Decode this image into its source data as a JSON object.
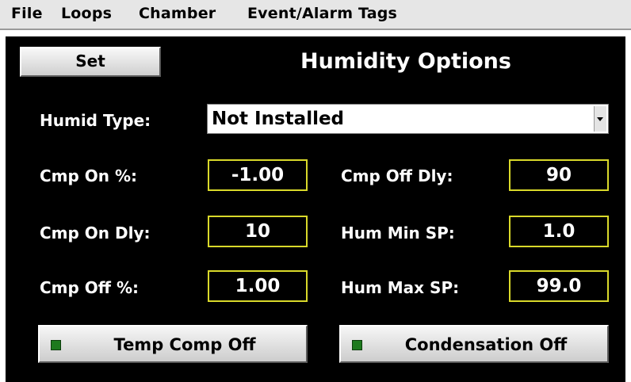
{
  "menu": {
    "file": "File",
    "loops": "Loops",
    "chamber": "Chamber",
    "event_alarm_tags": "Event/Alarm Tags"
  },
  "toolbar": {
    "set_label": "Set"
  },
  "screen": {
    "title": "Humidity Options"
  },
  "humid_type": {
    "label": "Humid Type:",
    "value": "Not Installed"
  },
  "fields": {
    "cmp_on_pct": {
      "label": "Cmp On %:",
      "value": "-1.00"
    },
    "cmp_on_dly": {
      "label": "Cmp On Dly:",
      "value": "10"
    },
    "cmp_off_pct": {
      "label": "Cmp Off %:",
      "value": "1.00"
    },
    "cmp_off_dly": {
      "label": "Cmp Off Dly:",
      "value": "90"
    },
    "hum_min_sp": {
      "label": "Hum Min SP:",
      "value": "1.0"
    },
    "hum_max_sp": {
      "label": "Hum Max SP:",
      "value": "99.0"
    }
  },
  "toggles": {
    "temp_comp": {
      "label": "Temp Comp Off",
      "indicator_color": "#1e7a1e"
    },
    "condensation": {
      "label": "Condensation Off",
      "indicator_color": "#1e7a1e"
    }
  },
  "colors": {
    "panel_bg": "#000000",
    "field_border": "#d9d92a",
    "text": "#ffffff"
  }
}
